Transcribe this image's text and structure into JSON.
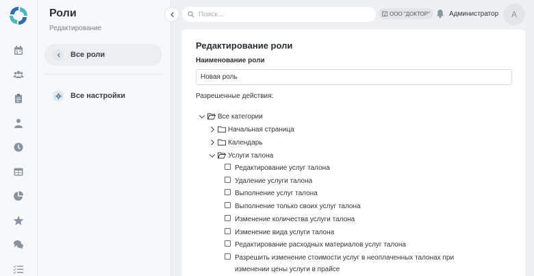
{
  "sidebar": {
    "title": "Роли",
    "subtitle": "Редактирование",
    "items": [
      {
        "label": "Все роли"
      },
      {
        "label": "Все настройки"
      }
    ]
  },
  "topbar": {
    "search_placeholder": "Поиск...",
    "org": "ООО \"ДОКТОР\"",
    "user": "Администратор",
    "avatar_letter": "А"
  },
  "form": {
    "title": "Редактирование роли",
    "name_label": "Наименование роли",
    "name_value": "Новая роль",
    "actions_label": "Разрешенные действия:"
  },
  "tree": {
    "root": "Все категории",
    "categories": [
      {
        "label": "Начальная страница"
      },
      {
        "label": "Календарь"
      },
      {
        "label": "Услуги талона"
      }
    ],
    "permissions": [
      "Редактирование услуг талона",
      "Удаление услуги талона",
      "Выполнение услуг талона",
      "Выполнение только своих услуг талона",
      "Изменение количества услуги талона",
      "Изменение вида услуги талона",
      "Редактирование расходных материалов услуг талона",
      "Разрешить изменение стоимости услуг в неоплаченных талонах при изменении цены услуги в прайсе"
    ]
  },
  "colors": {
    "accent": "#4a7fb0",
    "logo_blue": "#2d6fa8",
    "logo_teal": "#4fb7c4"
  }
}
